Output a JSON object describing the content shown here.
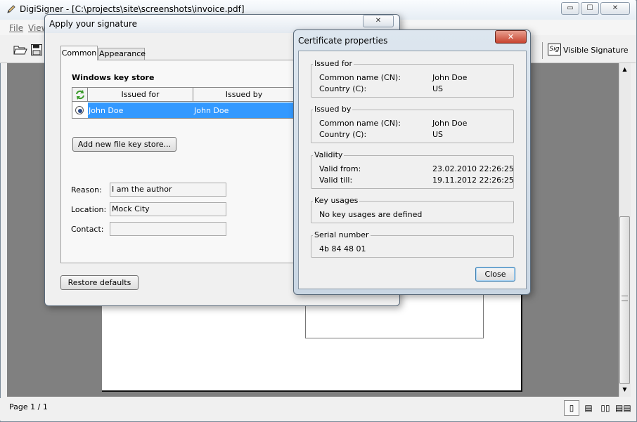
{
  "window": {
    "title": "DigiSigner - [C:\\projects\\site\\screenshots\\invoice.pdf]",
    "minimize": "▭",
    "maximize": "☐",
    "close": "✕"
  },
  "menu": {
    "file": "File",
    "view": "View"
  },
  "toolbar": {
    "visible_signature_icon": "Sig",
    "visible_signature_label": "Visible Signature"
  },
  "statusbar": {
    "page": "Page 1 / 1"
  },
  "apply_dialog": {
    "title": "Apply your signature",
    "close": "✕",
    "tabs": {
      "common": "Common",
      "appearance": "Appearance"
    },
    "key_store_heading": "Windows key store",
    "table": {
      "headers": {
        "issued_for": "Issued for",
        "issued_by": "Issued by"
      },
      "rows": [
        {
          "issued_for": "John Doe",
          "issued_by": "John Doe"
        }
      ]
    },
    "add_key_store": "Add new file key store...",
    "reason_label": "Reason:",
    "reason_value": "I am the author",
    "location_label": "Location:",
    "location_value": "Mock City",
    "contact_label": "Contact:",
    "contact_value": "",
    "restore_defaults": "Restore defaults"
  },
  "cert_dialog": {
    "title": "Certificate properties",
    "close": "✕",
    "issued_for": {
      "legend": "Issued for",
      "cn_label": "Common name (CN):",
      "cn_value": "John Doe",
      "c_label": "Country (C):",
      "c_value": "US"
    },
    "issued_by": {
      "legend": "Issued by",
      "cn_label": "Common name (CN):",
      "cn_value": "John Doe",
      "c_label": "Country (C):",
      "c_value": "US"
    },
    "validity": {
      "legend": "Validity",
      "from_label": "Valid from:",
      "from_value": "23.02.2010 22:26:25",
      "till_label": "Valid till:",
      "till_value": "19.11.2012 22:26:25"
    },
    "key_usages": {
      "legend": "Key usages",
      "value": "No key usages are defined"
    },
    "serial": {
      "legend": "Serial number",
      "value": "4b 84 48 01"
    },
    "close_button": "Close"
  }
}
